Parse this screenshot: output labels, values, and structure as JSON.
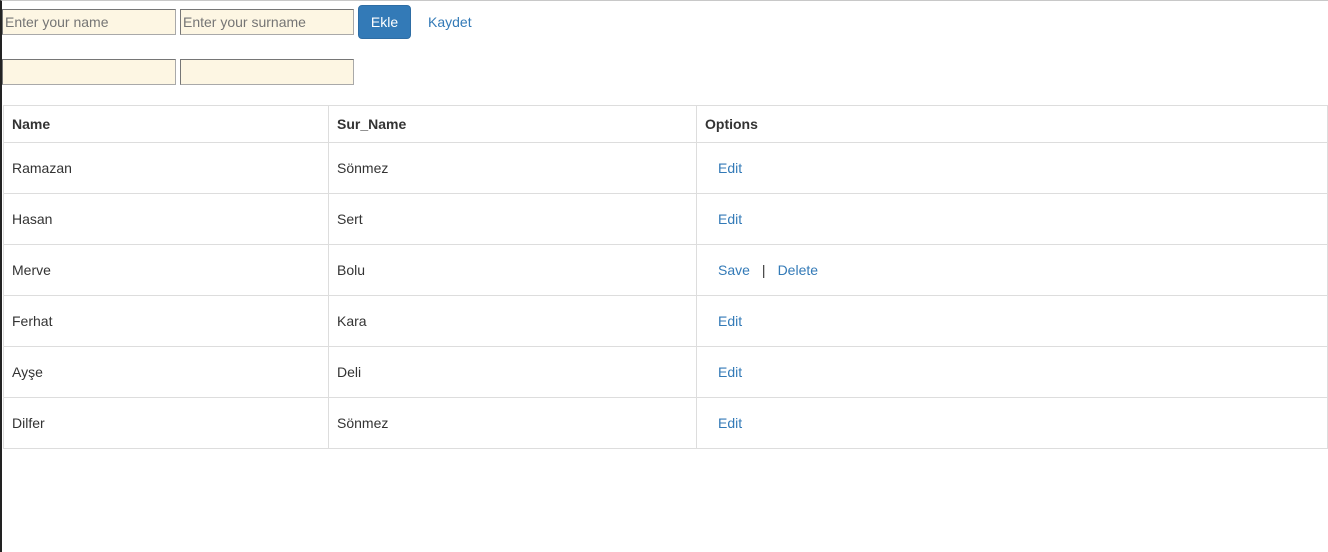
{
  "form": {
    "name_placeholder": "Enter your name",
    "surname_placeholder": "Enter your surname",
    "add_button_label": "Ekle",
    "save_link_label": "Kaydet",
    "edit_name_value": "",
    "edit_surname_value": ""
  },
  "table": {
    "headers": [
      "Name",
      "Sur_Name",
      "Options"
    ],
    "rows": [
      {
        "name": "Ramazan",
        "surname": "Sönmez",
        "mode": "view",
        "edit_label": "Edit"
      },
      {
        "name": "Hasan",
        "surname": "Sert",
        "mode": "view",
        "edit_label": "Edit"
      },
      {
        "name": "Merve",
        "surname": "Bolu",
        "mode": "edit",
        "save_label": "Save",
        "separator": "|",
        "delete_label": "Delete"
      },
      {
        "name": "Ferhat",
        "surname": "Kara",
        "mode": "view",
        "edit_label": "Edit"
      },
      {
        "name": "Ayşe",
        "surname": "Deli",
        "mode": "view",
        "edit_label": "Edit"
      },
      {
        "name": "Dilfer",
        "surname": "Sönmez",
        "mode": "view",
        "edit_label": "Edit"
      }
    ]
  },
  "colors": {
    "primary": "#337ab7",
    "input_background": "#fdf6e3",
    "table_border": "#dddddd"
  }
}
